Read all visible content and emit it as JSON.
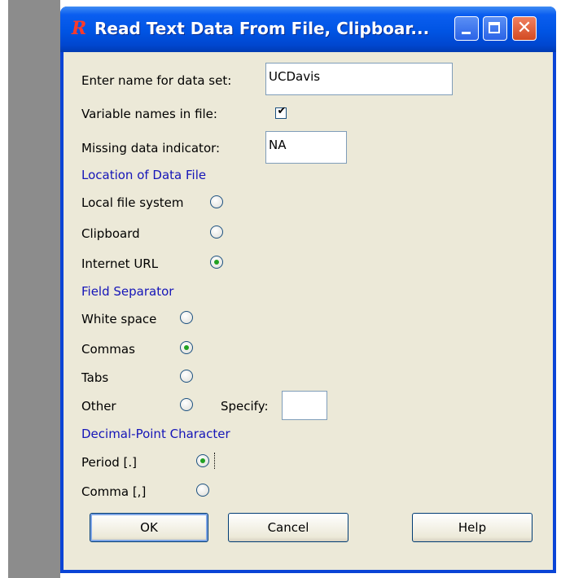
{
  "window": {
    "title": "Read Text Data From File, Clipboar...",
    "app_icon_glyph": "R"
  },
  "form": {
    "dataset_name_label": "Enter name for data set:",
    "dataset_name_value": "UCDavis",
    "variable_names_label": "Variable names in file:",
    "variable_names_checked": true,
    "missing_label": "Missing data indicator:",
    "missing_value": "NA"
  },
  "location": {
    "heading": "Location of Data File",
    "options": [
      {
        "label": "Local file system",
        "selected": false
      },
      {
        "label": "Clipboard",
        "selected": false
      },
      {
        "label": "Internet URL",
        "selected": true
      }
    ]
  },
  "separator": {
    "heading": "Field Separator",
    "options": [
      {
        "label": "White space",
        "selected": false
      },
      {
        "label": "Commas",
        "selected": true
      },
      {
        "label": "Tabs",
        "selected": false
      },
      {
        "label": "Other",
        "selected": false
      }
    ],
    "specify_label": "Specify:",
    "specify_value": ""
  },
  "decimal": {
    "heading": "Decimal-Point Character",
    "options": [
      {
        "label": "Period [.]",
        "selected": true
      },
      {
        "label": "Comma [,]",
        "selected": false
      }
    ]
  },
  "buttons": {
    "ok": "OK",
    "cancel": "Cancel",
    "help": "Help"
  }
}
